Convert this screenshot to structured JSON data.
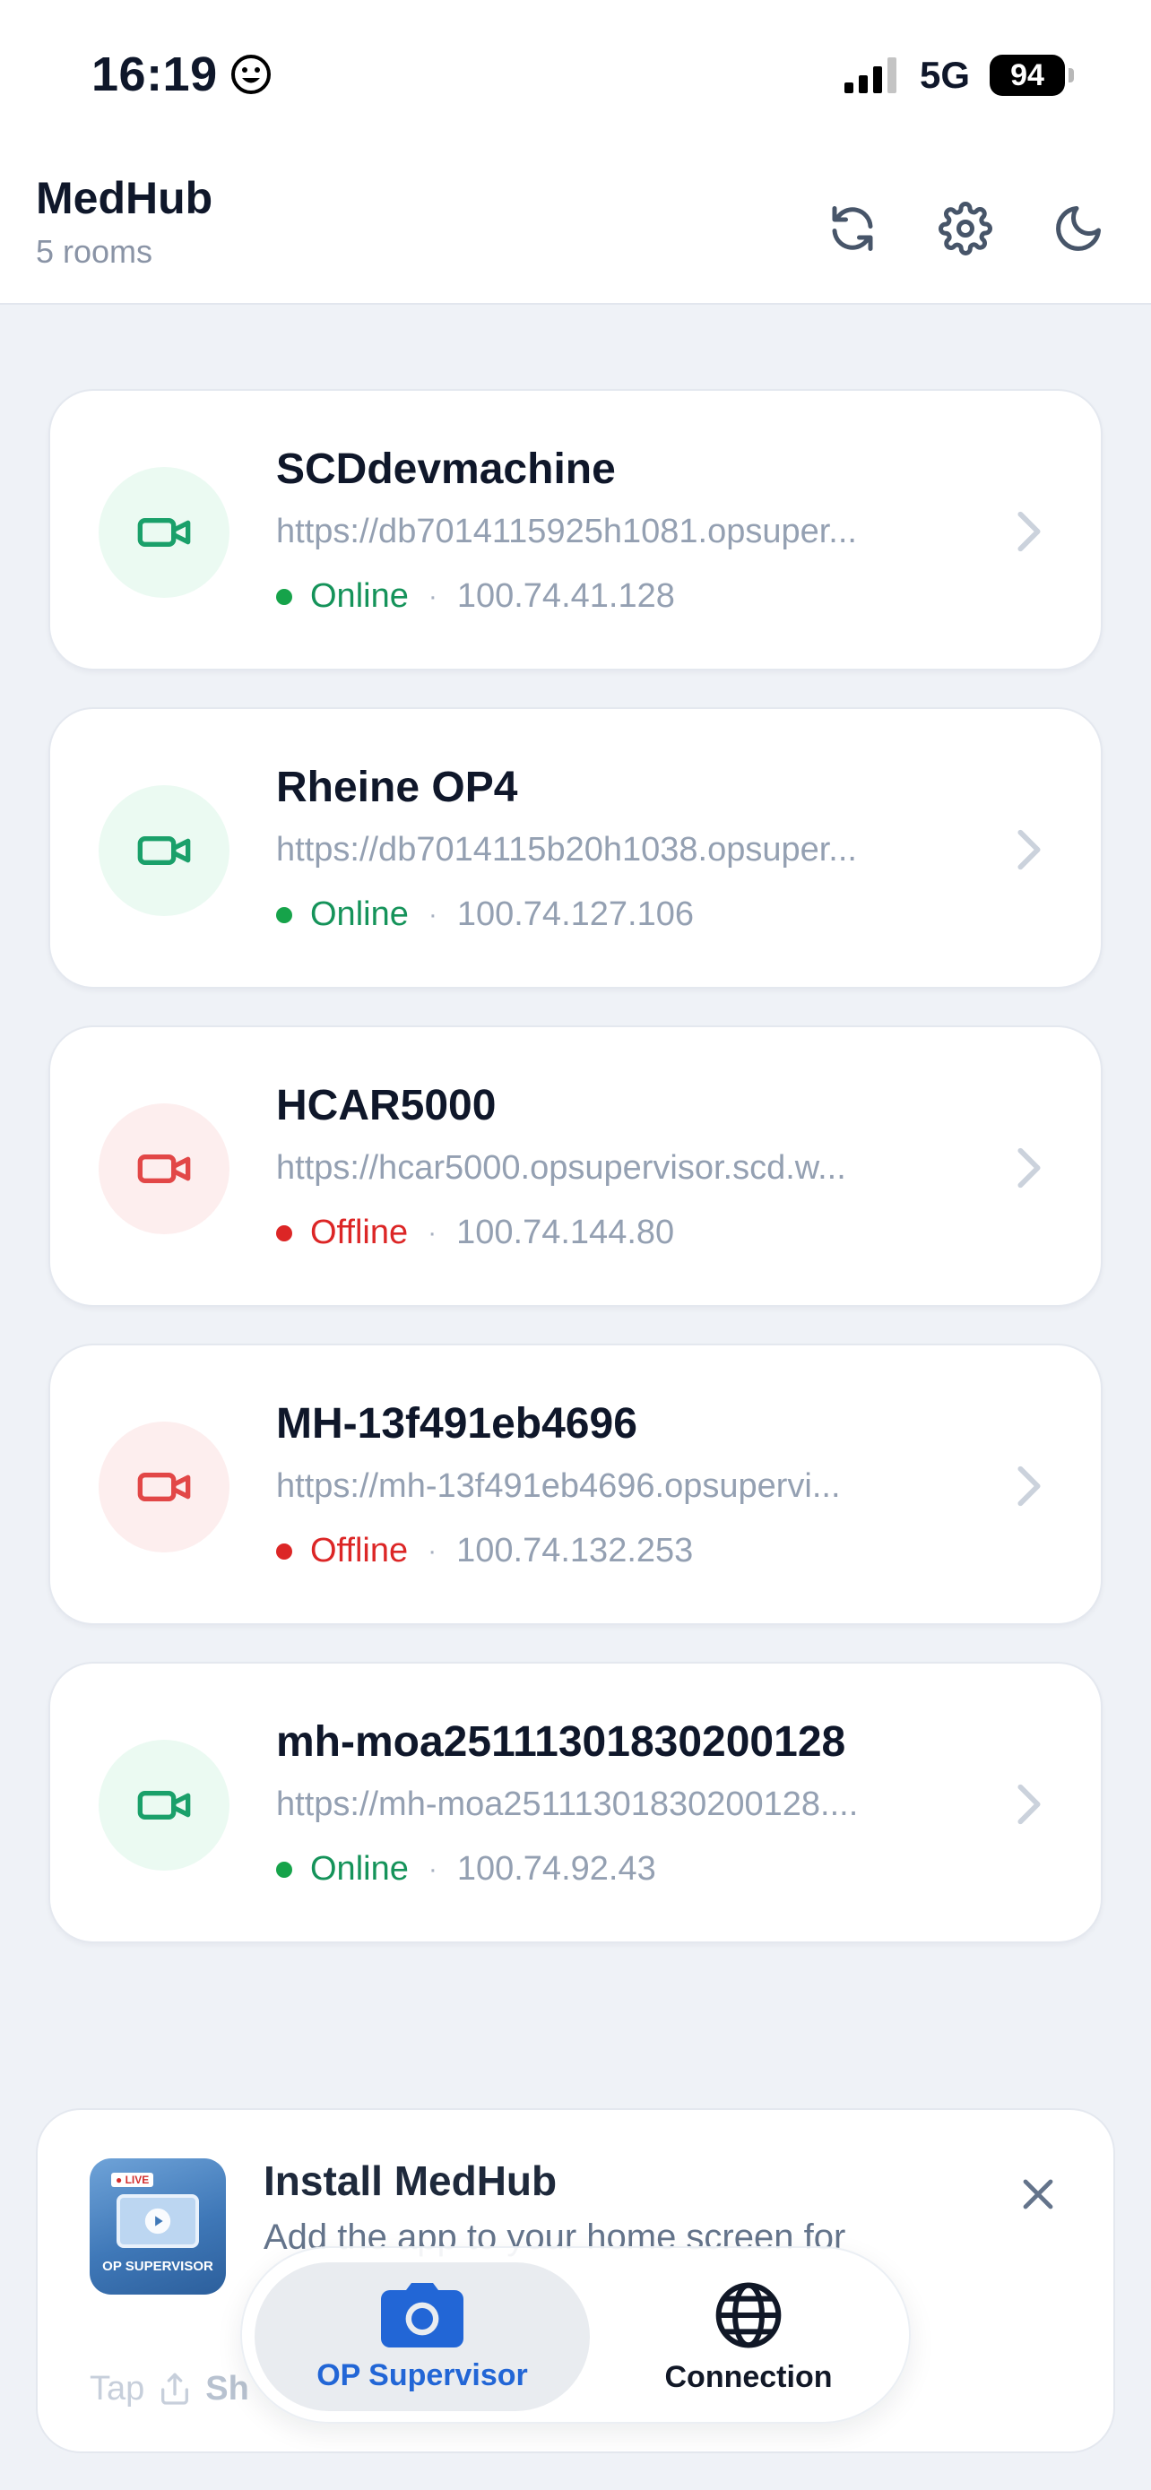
{
  "status_bar": {
    "time": "16:19",
    "network": "5G",
    "battery": "94"
  },
  "header": {
    "title": "MedHub",
    "subtitle": "5 rooms",
    "actions": [
      "refresh-icon",
      "gear-icon",
      "moon-icon"
    ]
  },
  "colors": {
    "online": "#15935a",
    "offline": "#dc2626",
    "accent": "#2266d6"
  },
  "rooms": [
    {
      "name": "SCDdevmachine",
      "url": "https://db7014115925h1081.opsuper...",
      "status": "Online",
      "state": "online",
      "ip": "100.74.41.128"
    },
    {
      "name": "Rheine OP4",
      "url": "https://db7014115b20h1038.opsuper...",
      "status": "Online",
      "state": "online",
      "ip": "100.74.127.106"
    },
    {
      "name": "HCAR5000",
      "url": "https://hcar5000.opsupervisor.scd.w...",
      "status": "Offline",
      "state": "offline",
      "ip": "100.74.144.80"
    },
    {
      "name": "MH-13f491eb4696",
      "url": "https://mh-13f491eb4696.opsupervi...",
      "status": "Offline",
      "state": "offline",
      "ip": "100.74.132.253"
    },
    {
      "name": "mh-moa25111301830200128",
      "url": "https://mh-moa25111301830200128....",
      "status": "Online",
      "state": "online",
      "ip": "100.74.92.43"
    }
  ],
  "install": {
    "title": "Install MedHub",
    "description": "Add the app to your home screen for",
    "tip_prefix": "Tap",
    "tip_partial": "Sh"
  },
  "tabs": [
    {
      "label": "OP Supervisor",
      "icon": "camera-icon",
      "active": true
    },
    {
      "label": "Connection",
      "icon": "globe-icon",
      "active": false
    }
  ]
}
